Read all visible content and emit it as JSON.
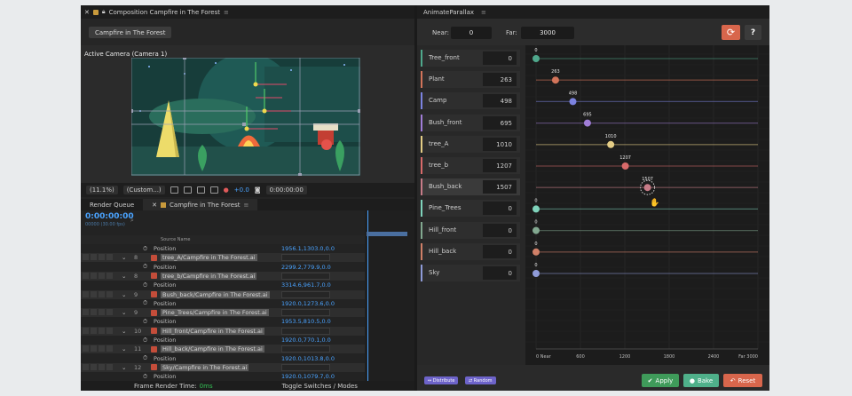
{
  "ae": {
    "window_title": "Composition Campfire in The Forest",
    "comp_tab": "Campfire in The Forest",
    "viewer_label": "Active Camera (Camera 1)",
    "zoom": "(11.1%)",
    "resolution": "(Custom...)",
    "exposure": "+0.0",
    "viewer_timecode": "0:00:00:00",
    "panel_tab_render": "Render Queue",
    "panel_tab_comp": "Campfire in The Forest",
    "timecode": "0:00:00:00",
    "frame_info": "00000 (30.00 fps)",
    "col_source_name": "Source Name",
    "layers": [
      {
        "kind": "prop",
        "name": "Position",
        "value": "1956.1,1303.0,0.0"
      },
      {
        "kind": "layer",
        "num": "8",
        "name": "tree_A/Campfire in The Forest.ai"
      },
      {
        "kind": "prop",
        "name": "Position",
        "value": "2299.2,779.9,0.0"
      },
      {
        "kind": "layer",
        "num": "8",
        "name": "tree_b/Campfire in The Forest.ai"
      },
      {
        "kind": "prop",
        "name": "Position",
        "value": "3314.6,961.7,0.0"
      },
      {
        "kind": "layer",
        "num": "9",
        "name": "Bush_back/Campfire in The Forest.ai"
      },
      {
        "kind": "prop",
        "name": "Position",
        "value": "1920.0,1273.6,0.0"
      },
      {
        "kind": "layer",
        "num": "9",
        "name": "Pine_Trees/Campfire in The Forest.ai"
      },
      {
        "kind": "prop",
        "name": "Position",
        "value": "1953.5,810.5,0.0"
      },
      {
        "kind": "layer",
        "num": "10",
        "name": "Hill_front/Campfire in The Forest.ai"
      },
      {
        "kind": "prop",
        "name": "Position",
        "value": "1920.0,770.1,0.0"
      },
      {
        "kind": "layer",
        "num": "11",
        "name": "Hill_back/Campfire in The Forest.ai"
      },
      {
        "kind": "prop",
        "name": "Position",
        "value": "1920.0,1013.8,0.0"
      },
      {
        "kind": "layer",
        "num": "12",
        "name": "Sky/Campfire in The Forest.ai"
      },
      {
        "kind": "prop",
        "name": "Position",
        "value": "1920.0,1079.7,0.0"
      }
    ],
    "footer_render": "Frame Render Time:",
    "footer_render_value": "0ms",
    "footer_toggle": "Toggle Switches / Modes"
  },
  "ap": {
    "title": "AnimateParallax",
    "near_label": "Near:",
    "near_value": "0",
    "far_label": "Far:",
    "far_value": "3000",
    "help_label": "?",
    "items": [
      {
        "name": "Tree_front",
        "value": "0",
        "color": "#4fa88c"
      },
      {
        "name": "Plant",
        "value": "263",
        "color": "#d2745a"
      },
      {
        "name": "Camp",
        "value": "498",
        "color": "#7c83e0"
      },
      {
        "name": "Bush_front",
        "value": "695",
        "color": "#a17ed8"
      },
      {
        "name": "tree_A",
        "value": "1010",
        "color": "#e4cd86"
      },
      {
        "name": "tree_b",
        "value": "1207",
        "color": "#d86a6a"
      },
      {
        "name": "Bush_back",
        "value": "1507",
        "color": "#c77c88"
      },
      {
        "name": "Pine_Trees",
        "value": "0",
        "color": "#7fd3bb"
      },
      {
        "name": "Hill_front",
        "value": "0",
        "color": "#82a890"
      },
      {
        "name": "Hill_back",
        "value": "0",
        "color": "#d08068"
      },
      {
        "name": "Sky",
        "value": "0",
        "color": "#8f9bd8"
      }
    ],
    "axis_ticks": [
      "0 Near",
      "600",
      "1200",
      "1800",
      "2400",
      "Far 3000"
    ],
    "pill_distribute": "Distribute",
    "pill_random": "Random",
    "apply_label": "Apply",
    "bake_label": "Bake",
    "reset_label": "Reset",
    "colors": {
      "apply": "#3f9b5a",
      "bake": "#4fb08a",
      "reset": "#d8664c",
      "pill": "#6d63c9"
    }
  }
}
